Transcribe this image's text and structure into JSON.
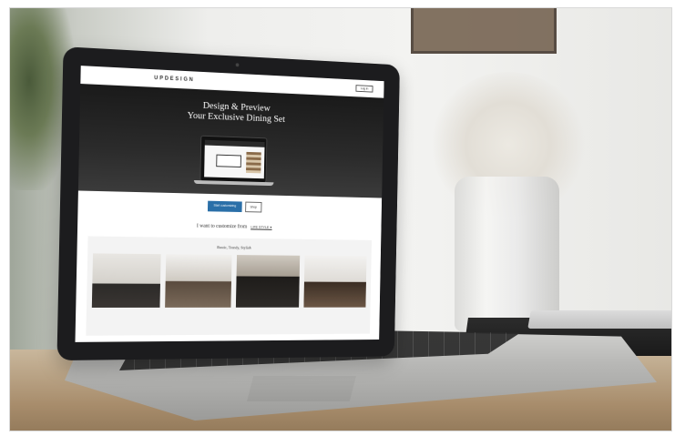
{
  "photo": {
    "scene": "laptop on wooden table",
    "colors": {
      "lid": "#1c1c1e",
      "hero": "#2b2b2b",
      "accent": "#2a6fa8"
    }
  },
  "site": {
    "brand": "UPDESIGN",
    "header_button": "Log In",
    "hero": {
      "title_line1": "Design & Preview",
      "title_line2": "Your Exclusive Dining Set"
    },
    "cta_primary": "Start customizing",
    "cta_secondary": "Shop",
    "customize_prompt": "I want to customize from",
    "customize_select": "LIFE STYLE ▾",
    "gallery_title": "Rustic, Trendy, Stylish",
    "gallery_subtitle": "",
    "tiles": [
      {
        "link": ""
      },
      {
        "link": ""
      },
      {
        "link": ""
      },
      {
        "link": ""
      }
    ]
  }
}
